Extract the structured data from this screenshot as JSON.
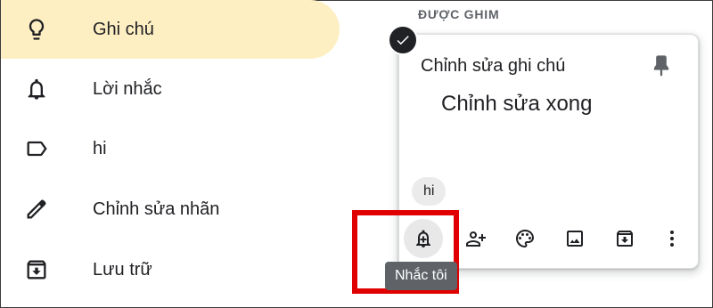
{
  "sidebar": {
    "items": [
      {
        "label": "Ghi chú",
        "icon": "lightbulb-icon",
        "active": true
      },
      {
        "label": "Lời nhắc",
        "icon": "bell-icon",
        "active": false
      },
      {
        "label": "hi",
        "icon": "label-tag-icon",
        "active": false
      },
      {
        "label": "Chỉnh sửa nhãn",
        "icon": "pencil-icon",
        "active": false
      },
      {
        "label": "Lưu trữ",
        "icon": "archive-icon",
        "active": false
      }
    ]
  },
  "pinned_section": {
    "header": "ĐƯỢC GHIM"
  },
  "note": {
    "title": "Chỉnh sửa ghi chú",
    "body": "Chỉnh sửa xong",
    "label_chip": "hi",
    "toolbar": [
      "remind-me-icon",
      "collaborator-icon",
      "palette-icon",
      "image-icon",
      "archive-icon",
      "more-vert-icon"
    ]
  },
  "tooltip": {
    "text": "Nhắc tôi"
  },
  "colors": {
    "active_nav_bg": "#feefc3",
    "highlight_border": "#e10000",
    "tooltip_bg": "#5f6368"
  }
}
